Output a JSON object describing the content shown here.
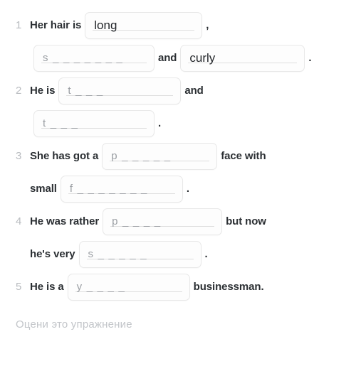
{
  "exercise": {
    "questions": [
      {
        "number": "1",
        "lines": [
          {
            "parts": [
              {
                "type": "text",
                "value": "Her hair is"
              },
              {
                "type": "input",
                "value": "long",
                "placeholder": "",
                "filled": true,
                "size": "w-long"
              },
              {
                "type": "text",
                "value": ","
              }
            ]
          },
          {
            "parts": [
              {
                "type": "input",
                "value": "",
                "placeholder": "s _ _ _ _ _ _ _",
                "filled": false,
                "size": "w-s7"
              },
              {
                "type": "text",
                "value": "and"
              },
              {
                "type": "input",
                "value": "curly",
                "placeholder": "",
                "filled": true,
                "size": "w-curly"
              },
              {
                "type": "text",
                "value": "."
              }
            ]
          }
        ]
      },
      {
        "number": "2",
        "lines": [
          {
            "parts": [
              {
                "type": "text",
                "value": "He is"
              },
              {
                "type": "input",
                "value": "",
                "placeholder": "t _ _ _",
                "filled": false,
                "size": "w-t3a"
              },
              {
                "type": "text",
                "value": "and"
              }
            ]
          },
          {
            "parts": [
              {
                "type": "input",
                "value": "",
                "placeholder": "t _ _ _",
                "filled": false,
                "size": "w-t3b"
              },
              {
                "type": "text",
                "value": "."
              }
            ]
          }
        ]
      },
      {
        "number": "3",
        "lines": [
          {
            "parts": [
              {
                "type": "text",
                "value": "She has got a"
              },
              {
                "type": "input",
                "value": "",
                "placeholder": "p _ _ _ _ _",
                "filled": false,
                "size": "w-p5"
              },
              {
                "type": "text",
                "value": "face with"
              }
            ]
          },
          {
            "parts": [
              {
                "type": "text",
                "value": "small"
              },
              {
                "type": "input",
                "value": "",
                "placeholder": "f _ _ _ _ _ _ _",
                "filled": false,
                "size": "w-f7"
              },
              {
                "type": "text",
                "value": "."
              }
            ]
          }
        ]
      },
      {
        "number": "4",
        "lines": [
          {
            "parts": [
              {
                "type": "text",
                "value": "He was rather"
              },
              {
                "type": "input",
                "value": "",
                "placeholder": "p _ _ _ _",
                "filled": false,
                "size": "w-p4"
              },
              {
                "type": "text",
                "value": "but now"
              }
            ]
          },
          {
            "parts": [
              {
                "type": "text",
                "value": "he's very"
              },
              {
                "type": "input",
                "value": "",
                "placeholder": "s _ _ _ _ _",
                "filled": false,
                "size": "w-s5"
              },
              {
                "type": "text",
                "value": "."
              }
            ]
          }
        ]
      },
      {
        "number": "5",
        "lines": [
          {
            "parts": [
              {
                "type": "text",
                "value": "He is a"
              },
              {
                "type": "input",
                "value": "",
                "placeholder": "y _ _ _ _",
                "filled": false,
                "size": "w-y4"
              },
              {
                "type": "text",
                "value": "businessman."
              }
            ]
          }
        ]
      }
    ]
  },
  "footer": {
    "rate_label": "Оцени это упражнение"
  },
  "colors": {
    "text": "#2b2f33",
    "number": "#b9bcc0",
    "placeholder": "#9a9ea3",
    "field_border": "#e8e8e8",
    "footer_text": "#c2c5c9",
    "background": "#ffffff"
  }
}
